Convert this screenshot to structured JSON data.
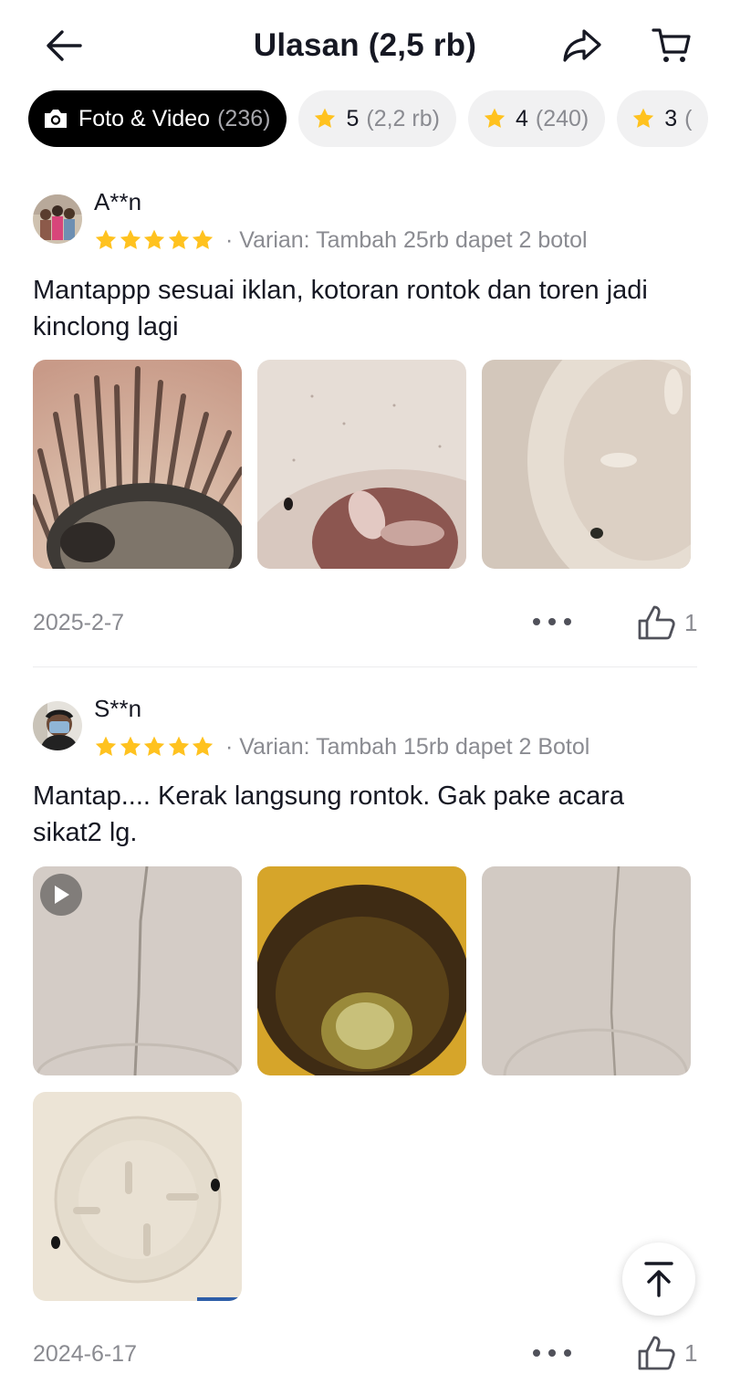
{
  "header": {
    "title": "Ulasan (2,5 rb)",
    "back_icon": "arrow-left-icon",
    "share_icon": "share-arrow-icon",
    "cart_icon": "cart-icon"
  },
  "filters": [
    {
      "label": "Foto & Video",
      "count": "(236)",
      "icon": "camera-icon",
      "active": true
    },
    {
      "label": "5",
      "count": "(2,2 rb)",
      "icon": "star-icon",
      "active": false
    },
    {
      "label": "4",
      "count": "(240)",
      "icon": "star-icon",
      "active": false
    },
    {
      "label": "3",
      "count": "(",
      "icon": "star-icon",
      "active": false
    }
  ],
  "colors": {
    "star": "#FFC21F",
    "chip_active": "#000000",
    "chip_bg": "#F1F1F2",
    "muted": "#8A8B91"
  },
  "reviews": [
    {
      "name": "A**n",
      "rating": 5,
      "variant": "· Varian: Tambah 25rb dapet 2 botol",
      "text": "Mantappp sesuai iklan, kotoran rontok dan toren jadi kinclong lagi",
      "date": "2025-2-7",
      "likes": "1",
      "media_count": 3
    },
    {
      "name": "S**n",
      "rating": 5,
      "variant": "· Varian: Tambah 15rb dapet 2 Botol",
      "text": "Mantap.... Kerak langsung rontok. Gak pake acara sikat2 lg.",
      "date": "2024-6-17",
      "likes": "1",
      "media_count": 4
    }
  ],
  "scroll_top_icon": "arrow-to-top-icon"
}
